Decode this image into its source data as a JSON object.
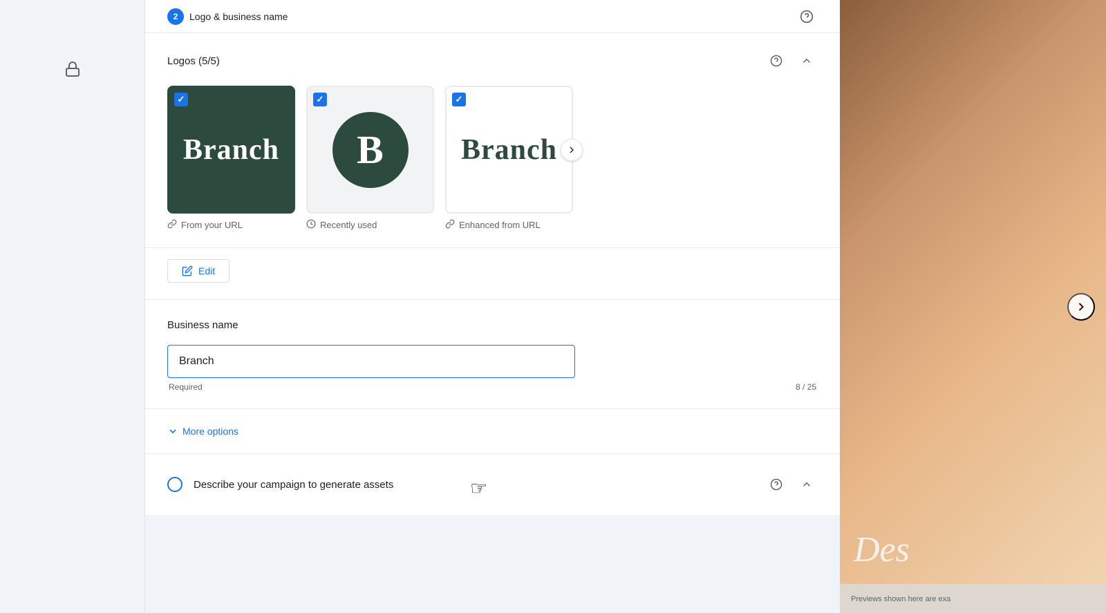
{
  "sidebar": {
    "lock_icon": "🔒"
  },
  "top_bar": {
    "step_number": "2",
    "step_label": "Logo & business name",
    "help_icon": "?"
  },
  "logos_section": {
    "title": "Logos (5/5)",
    "help_icon": "?",
    "collapse_icon": "^",
    "cards": [
      {
        "type": "dark-green",
        "text": "Branch",
        "checked": true,
        "label": "From your URL",
        "label_icon": "🔗"
      },
      {
        "type": "light-gray",
        "text": "B",
        "checked": true,
        "label": "Recently used",
        "label_icon": "🕐"
      },
      {
        "type": "white",
        "text": "Branch",
        "checked": true,
        "label": "Enhanced from URL",
        "label_icon": "🔗",
        "has_next": true
      }
    ]
  },
  "edit_button": {
    "label": "Edit",
    "icon": "✏️"
  },
  "business_name_section": {
    "label": "Business name",
    "input_value": "Branch",
    "input_placeholder": "Branch",
    "required_text": "Required",
    "char_count": "8 / 25"
  },
  "more_options": {
    "label": "More options",
    "icon": "chevron-down"
  },
  "describe_section": {
    "label": "Describe your campaign to generate assets",
    "help_icon": "?",
    "collapse_icon": "^"
  },
  "preview": {
    "note": "Previews shown here are exa",
    "overlay_text": "Des"
  },
  "cursor": {
    "symbol": "👆"
  }
}
